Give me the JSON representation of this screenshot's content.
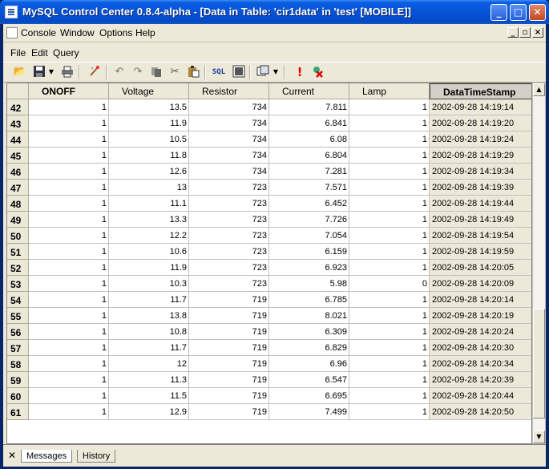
{
  "window": {
    "title": "MySQL Control Center 0.8.4-alpha - [Data in Table: 'cir1data' in 'test' [MOBILE]]",
    "minimize_glyph": "_",
    "maximize_glyph": "□",
    "close_glyph": "✕"
  },
  "menubar_main": [
    "Console",
    "Window",
    "Options",
    "Help"
  ],
  "menubar_query": [
    "File",
    "Edit",
    "Query"
  ],
  "mdi_controls": [
    "_",
    "▫",
    "×"
  ],
  "toolbar_icons": [
    "open-folder-icon",
    "save-icon",
    "print-icon",
    "clear-icon",
    "undo-icon",
    "redo-icon",
    "copy-icon",
    "cut-icon",
    "paste-icon",
    "sql-icon",
    "stop-icon",
    "view-icon",
    "execute-icon",
    "cancel-icon"
  ],
  "toolbar_sql_label": "SQL",
  "grid": {
    "columns": [
      "ONOFF",
      "Voltage",
      "Resistor",
      "Current",
      "Lamp",
      "DataTimeStamp"
    ],
    "rows": [
      {
        "n": "42",
        "onoff": "1",
        "voltage": "13.5",
        "resistor": "734",
        "current": "7.811",
        "lamp": "1",
        "ts": "2002-09-28 14:19:14"
      },
      {
        "n": "43",
        "onoff": "1",
        "voltage": "11.9",
        "resistor": "734",
        "current": "6.841",
        "lamp": "1",
        "ts": "2002-09-28 14:19:20"
      },
      {
        "n": "44",
        "onoff": "1",
        "voltage": "10.5",
        "resistor": "734",
        "current": "6.08",
        "lamp": "1",
        "ts": "2002-09-28 14:19:24"
      },
      {
        "n": "45",
        "onoff": "1",
        "voltage": "11.8",
        "resistor": "734",
        "current": "6.804",
        "lamp": "1",
        "ts": "2002-09-28 14:19:29"
      },
      {
        "n": "46",
        "onoff": "1",
        "voltage": "12.6",
        "resistor": "734",
        "current": "7.281",
        "lamp": "1",
        "ts": "2002-09-28 14:19:34"
      },
      {
        "n": "47",
        "onoff": "1",
        "voltage": "13",
        "resistor": "723",
        "current": "7.571",
        "lamp": "1",
        "ts": "2002-09-28 14:19:39"
      },
      {
        "n": "48",
        "onoff": "1",
        "voltage": "11.1",
        "resistor": "723",
        "current": "6.452",
        "lamp": "1",
        "ts": "2002-09-28 14:19:44"
      },
      {
        "n": "49",
        "onoff": "1",
        "voltage": "13.3",
        "resistor": "723",
        "current": "7.726",
        "lamp": "1",
        "ts": "2002-09-28 14:19:49"
      },
      {
        "n": "50",
        "onoff": "1",
        "voltage": "12.2",
        "resistor": "723",
        "current": "7.054",
        "lamp": "1",
        "ts": "2002-09-28 14:19:54"
      },
      {
        "n": "51",
        "onoff": "1",
        "voltage": "10.6",
        "resistor": "723",
        "current": "6.159",
        "lamp": "1",
        "ts": "2002-09-28 14:19:59"
      },
      {
        "n": "52",
        "onoff": "1",
        "voltage": "11.9",
        "resistor": "723",
        "current": "6.923",
        "lamp": "1",
        "ts": "2002-09-28 14:20:05"
      },
      {
        "n": "53",
        "onoff": "1",
        "voltage": "10.3",
        "resistor": "723",
        "current": "5.98",
        "lamp": "0",
        "ts": "2002-09-28 14:20:09"
      },
      {
        "n": "54",
        "onoff": "1",
        "voltage": "11.7",
        "resistor": "719",
        "current": "6.785",
        "lamp": "1",
        "ts": "2002-09-28 14:20:14"
      },
      {
        "n": "55",
        "onoff": "1",
        "voltage": "13.8",
        "resistor": "719",
        "current": "8.021",
        "lamp": "1",
        "ts": "2002-09-28 14:20:19"
      },
      {
        "n": "56",
        "onoff": "1",
        "voltage": "10.8",
        "resistor": "719",
        "current": "6.309",
        "lamp": "1",
        "ts": "2002-09-28 14:20:24"
      },
      {
        "n": "57",
        "onoff": "1",
        "voltage": "11.7",
        "resistor": "719",
        "current": "6.829",
        "lamp": "1",
        "ts": "2002-09-28 14:20:30"
      },
      {
        "n": "58",
        "onoff": "1",
        "voltage": "12",
        "resistor": "719",
        "current": "6.96",
        "lamp": "1",
        "ts": "2002-09-28 14:20:34"
      },
      {
        "n": "59",
        "onoff": "1",
        "voltage": "11.3",
        "resistor": "719",
        "current": "6.547",
        "lamp": "1",
        "ts": "2002-09-28 14:20:39"
      },
      {
        "n": "60",
        "onoff": "1",
        "voltage": "11.5",
        "resistor": "719",
        "current": "6.695",
        "lamp": "1",
        "ts": "2002-09-28 14:20:44"
      },
      {
        "n": "61",
        "onoff": "1",
        "voltage": "12.9",
        "resistor": "719",
        "current": "7.499",
        "lamp": "1",
        "ts": "2002-09-28 14:20:50"
      }
    ]
  },
  "bottom_tabs": [
    "Messages",
    "History"
  ],
  "bottom_close_glyph": "✕",
  "scroll_up_glyph": "▲",
  "scroll_down_glyph": "▼"
}
